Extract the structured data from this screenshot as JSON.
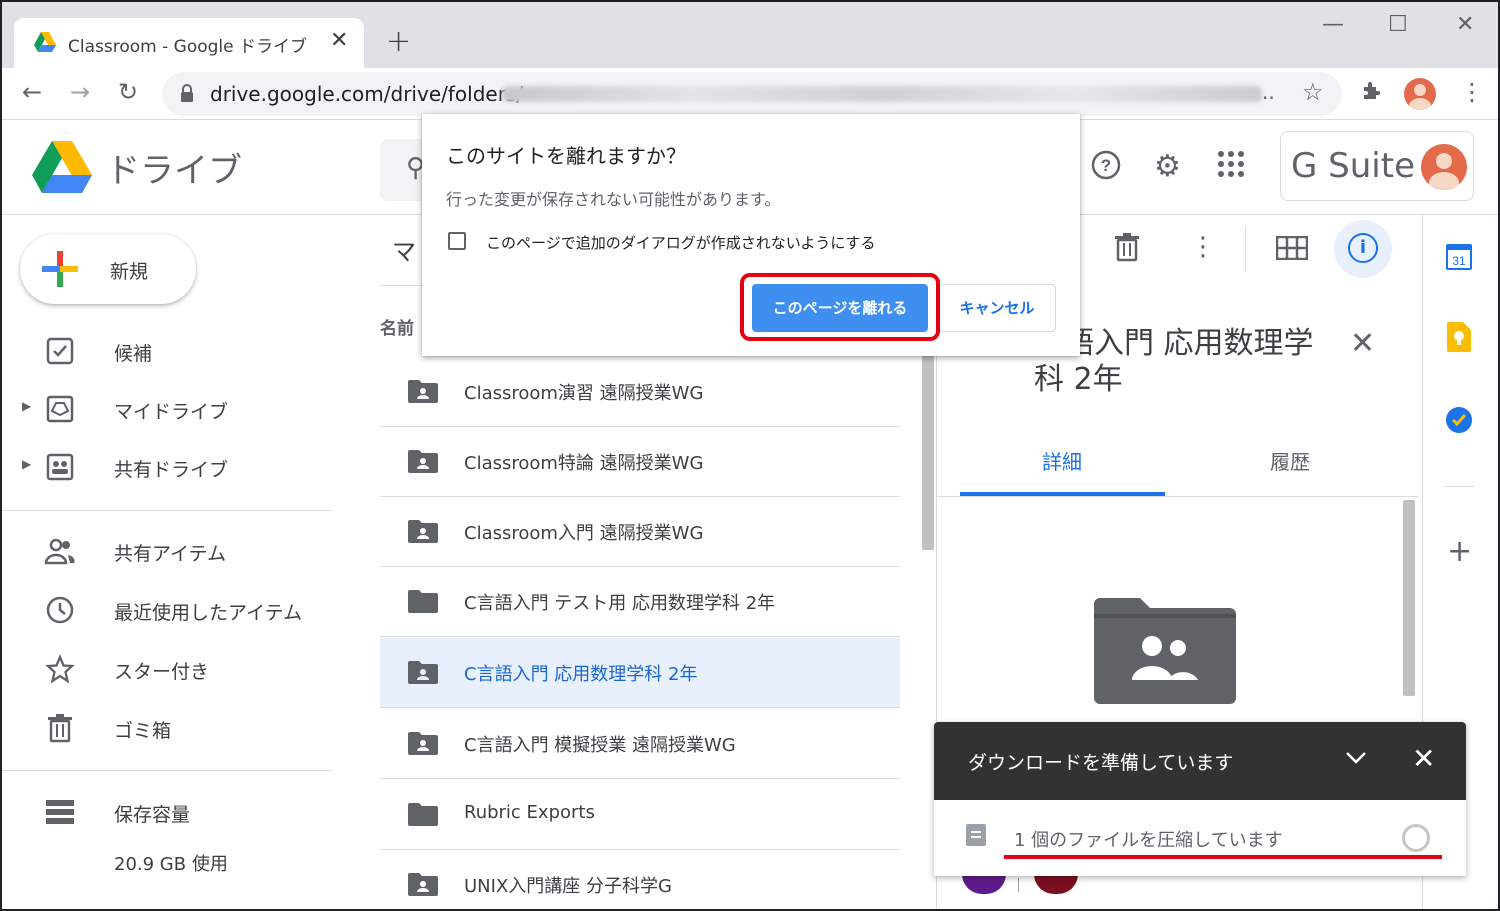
{
  "browser": {
    "tab_title": "Classroom - Google ドライブ",
    "tab_close": "✕",
    "new_tab": "+",
    "url": "drive.google.com/drive/folders/",
    "url_ellipsis": "..",
    "window_controls": {
      "minimize": "—",
      "maximize": "☐",
      "close": "✕"
    }
  },
  "drive": {
    "app_name": "ドライブ",
    "gsuite_label": "G Suite",
    "new_button": "新規",
    "nav": [
      {
        "label": "候補",
        "icon": "checkbox-icon"
      },
      {
        "label": "マイドライブ",
        "icon": "my-drive-icon"
      },
      {
        "label": "共有ドライブ",
        "icon": "shared-drives-icon"
      },
      {
        "label": "共有アイテム",
        "icon": "people-icon"
      },
      {
        "label": "最近使用したアイテム",
        "icon": "clock-icon"
      },
      {
        "label": "スター付き",
        "icon": "star-icon"
      },
      {
        "label": "ゴミ箱",
        "icon": "trash-icon"
      },
      {
        "label": "保存容量",
        "icon": "storage-icon"
      }
    ],
    "storage_used": "20.9 GB 使用",
    "breadcrumb": "マ",
    "column_name": "名前",
    "files": [
      {
        "name": "Classroom演習 遠隔授業WG",
        "type": "shared-folder"
      },
      {
        "name": "Classroom特論 遠隔授業WG",
        "type": "shared-folder"
      },
      {
        "name": "Classroom入門 遠隔授業WG",
        "type": "shared-folder"
      },
      {
        "name": "C言語入門 テスト用 応用数理学科 2年",
        "type": "folder"
      },
      {
        "name": "C言語入門 応用数理学科 2年",
        "type": "shared-folder",
        "selected": true
      },
      {
        "name": "C言語入門 模擬授業 遠隔授業WG",
        "type": "shared-folder"
      },
      {
        "name": "Rubric Exports",
        "type": "folder"
      },
      {
        "name": "UNIX入門講座 分子科学G",
        "type": "shared-folder"
      }
    ]
  },
  "details": {
    "title": "言語入門 応用数理学科 2年",
    "tab_details": "詳細",
    "tab_activity": "履歴",
    "close": "✕"
  },
  "dialog": {
    "title": "このサイトを離れますか？",
    "message": "行った変更が保存されない可能性があります。",
    "checkbox_label": "このページで追加のダイアログが作成されないようにする",
    "leave_button": "このページを離れる",
    "cancel_button": "キャンセル"
  },
  "download": {
    "title": "ダウンロードを準備しています",
    "status": "1 個のファイルを圧縮しています"
  },
  "side_apps": {
    "calendar_day": "31",
    "add": "+"
  },
  "colors": {
    "accent": "#1a73e8",
    "highlight_red": "#e60012",
    "selected_row": "#e8f0fe"
  }
}
